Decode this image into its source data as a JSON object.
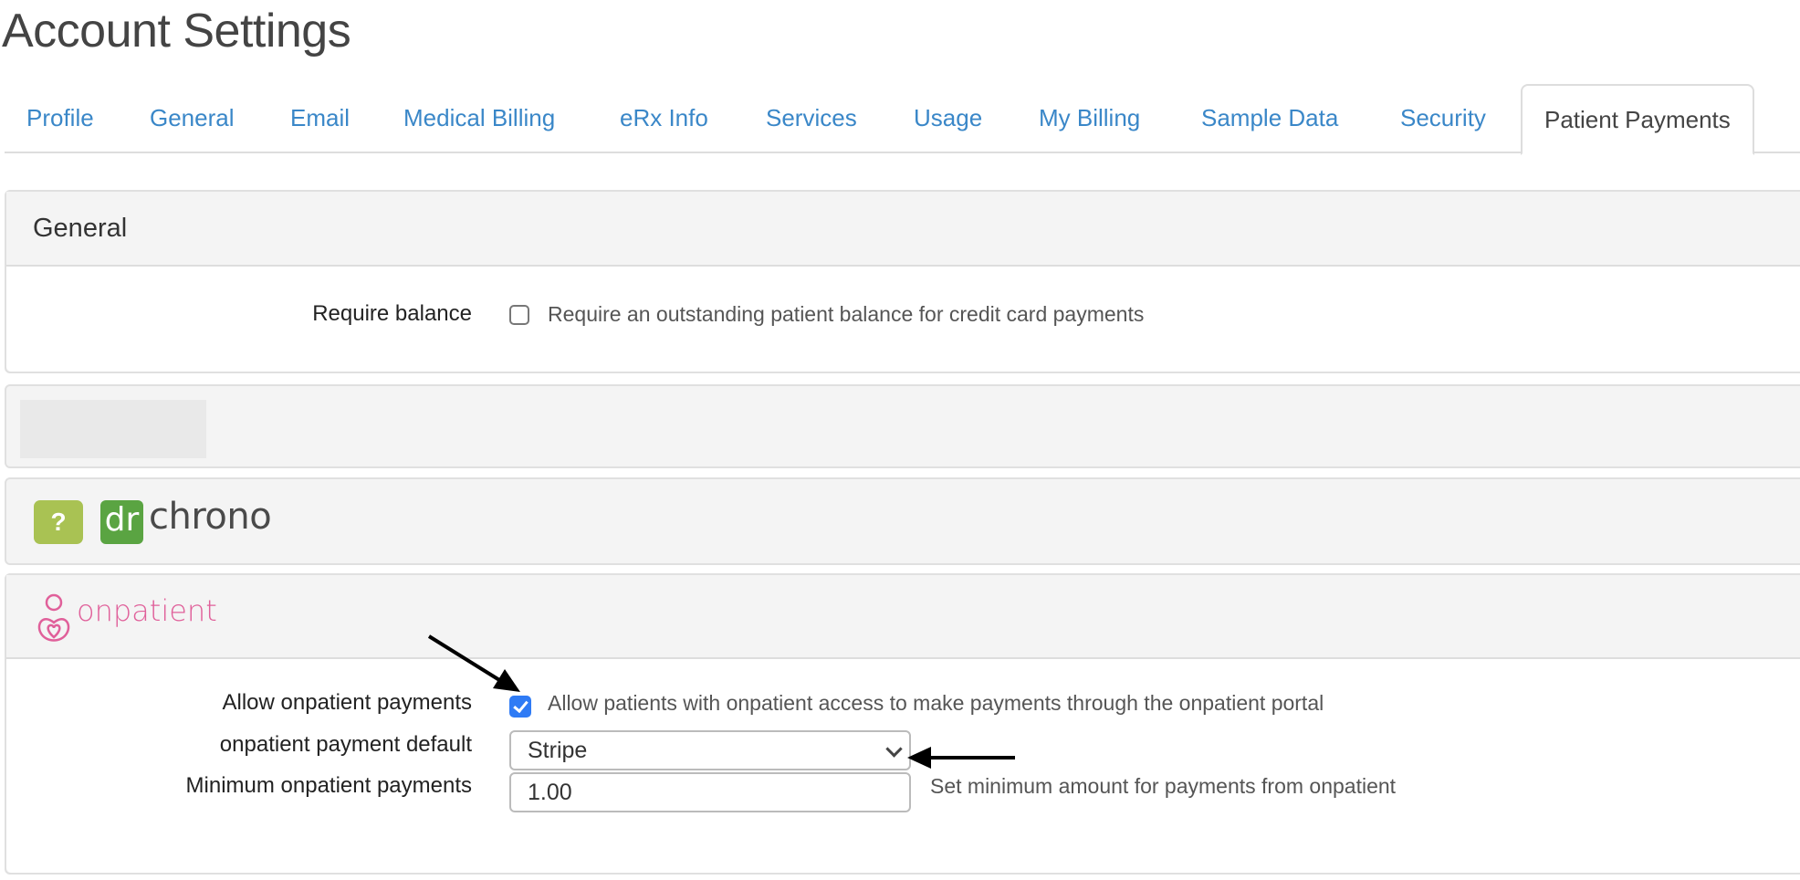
{
  "page": {
    "title": "Account Settings"
  },
  "tabs": [
    {
      "label": "Profile",
      "active": false
    },
    {
      "label": "General",
      "active": false
    },
    {
      "label": "Email",
      "active": false
    },
    {
      "label": "Medical Billing",
      "active": false
    },
    {
      "label": "eRx Info",
      "active": false
    },
    {
      "label": "Services",
      "active": false
    },
    {
      "label": "Usage",
      "active": false
    },
    {
      "label": "My Billing",
      "active": false
    },
    {
      "label": "Sample Data",
      "active": false
    },
    {
      "label": "Security",
      "active": false
    },
    {
      "label": "Patient Payments",
      "active": true
    }
  ],
  "general_panel": {
    "heading": "General",
    "require_balance": {
      "label": "Require balance",
      "checked": false,
      "help": "Require an outstanding patient balance for credit card payments"
    }
  },
  "drchrono_panel": {
    "help_icon": "?",
    "logo_dr": "dr",
    "logo_chrono": "chrono"
  },
  "onpatient_panel": {
    "logo_text": "onpatient",
    "allow_payments": {
      "label": "Allow onpatient payments",
      "checked": true,
      "help": "Allow patients with onpatient access to make payments through the onpatient portal"
    },
    "payment_default": {
      "label": "onpatient payment default",
      "selected": "Stripe"
    },
    "minimum_payments": {
      "label": "Minimum onpatient payments",
      "value": "1.00",
      "help": "Set minimum amount for payments from onpatient"
    }
  },
  "colors": {
    "link": "#3a87c8",
    "checkbox_checked": "#2f7bf5",
    "drchrono_green": "#5aa442",
    "help_green": "#a9c253",
    "onpatient_pink": "#e0609a"
  }
}
